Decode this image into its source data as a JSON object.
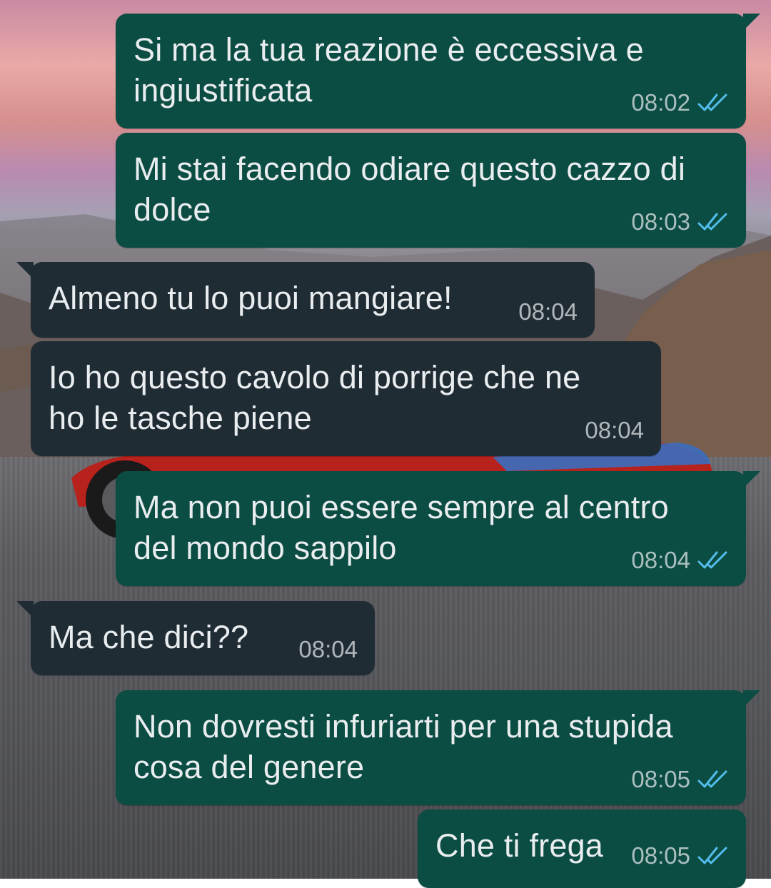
{
  "theme": {
    "outgoing_bubble": "#0b4c43",
    "incoming_bubble": "#1f2c34",
    "text_color": "#e9edef",
    "read_ticks_color": "#53bdeb"
  },
  "messages": [
    {
      "direction": "outgoing",
      "text": "Si ma la tua reazione è eccessiva e\ningiustificata",
      "time": "08:02",
      "status_icon": "double-check-read-icon"
    },
    {
      "direction": "outgoing",
      "text": "Mi stai facendo odiare questo cazzo di\ndolce",
      "time": "08:03",
      "status_icon": "double-check-read-icon"
    },
    {
      "direction": "incoming",
      "text": "Almeno tu lo puoi mangiare!",
      "time": "08:04"
    },
    {
      "direction": "incoming",
      "text": "Io ho questo cavolo di porrige che ne\nho le tasche piene",
      "time": "08:04"
    },
    {
      "direction": "outgoing",
      "text": "Ma non puoi essere sempre al centro\ndel mondo sappilo",
      "time": "08:04",
      "status_icon": "double-check-read-icon"
    },
    {
      "direction": "incoming",
      "text": "Ma che dici??",
      "time": "08:04"
    },
    {
      "direction": "outgoing",
      "text": "Non dovresti infuriarti per una stupida\ncosa del genere",
      "time": "08:05",
      "status_icon": "double-check-read-icon"
    },
    {
      "direction": "outgoing",
      "text": "Che ti frega",
      "time": "08:05",
      "status_icon": "double-check-read-icon"
    }
  ]
}
